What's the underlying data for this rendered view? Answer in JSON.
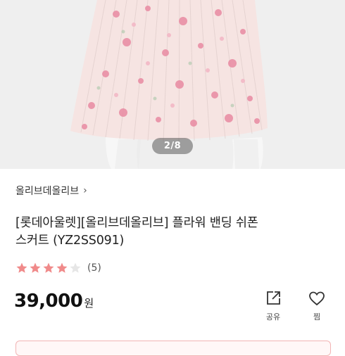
{
  "gallery": {
    "current": 2,
    "total": 8,
    "pager_text": "2/8"
  },
  "brand": {
    "name": "올리브데올리브",
    "chevron": "›"
  },
  "product": {
    "title_line1": "[롯데아울렛][올리브데올리브] 플라워 밴딩 쉬폰",
    "title_line2": "스커트 (YZ2SS091)"
  },
  "rating": {
    "score": 4,
    "max": 5,
    "review_count_text": "(5)"
  },
  "price": {
    "amount": "39,000",
    "unit": "원"
  },
  "actions": {
    "share_label": "공유",
    "like_label": "찜"
  },
  "icons": {
    "share": "share-icon",
    "heart": "heart-icon",
    "star": "star-icon"
  },
  "colors": {
    "star_filled": "#f08a8a",
    "star_empty": "#e6e6e6",
    "skirt_base": "#f6e4e2",
    "flower": "#e98aa2",
    "bottom_border": "#f2b4b4"
  }
}
